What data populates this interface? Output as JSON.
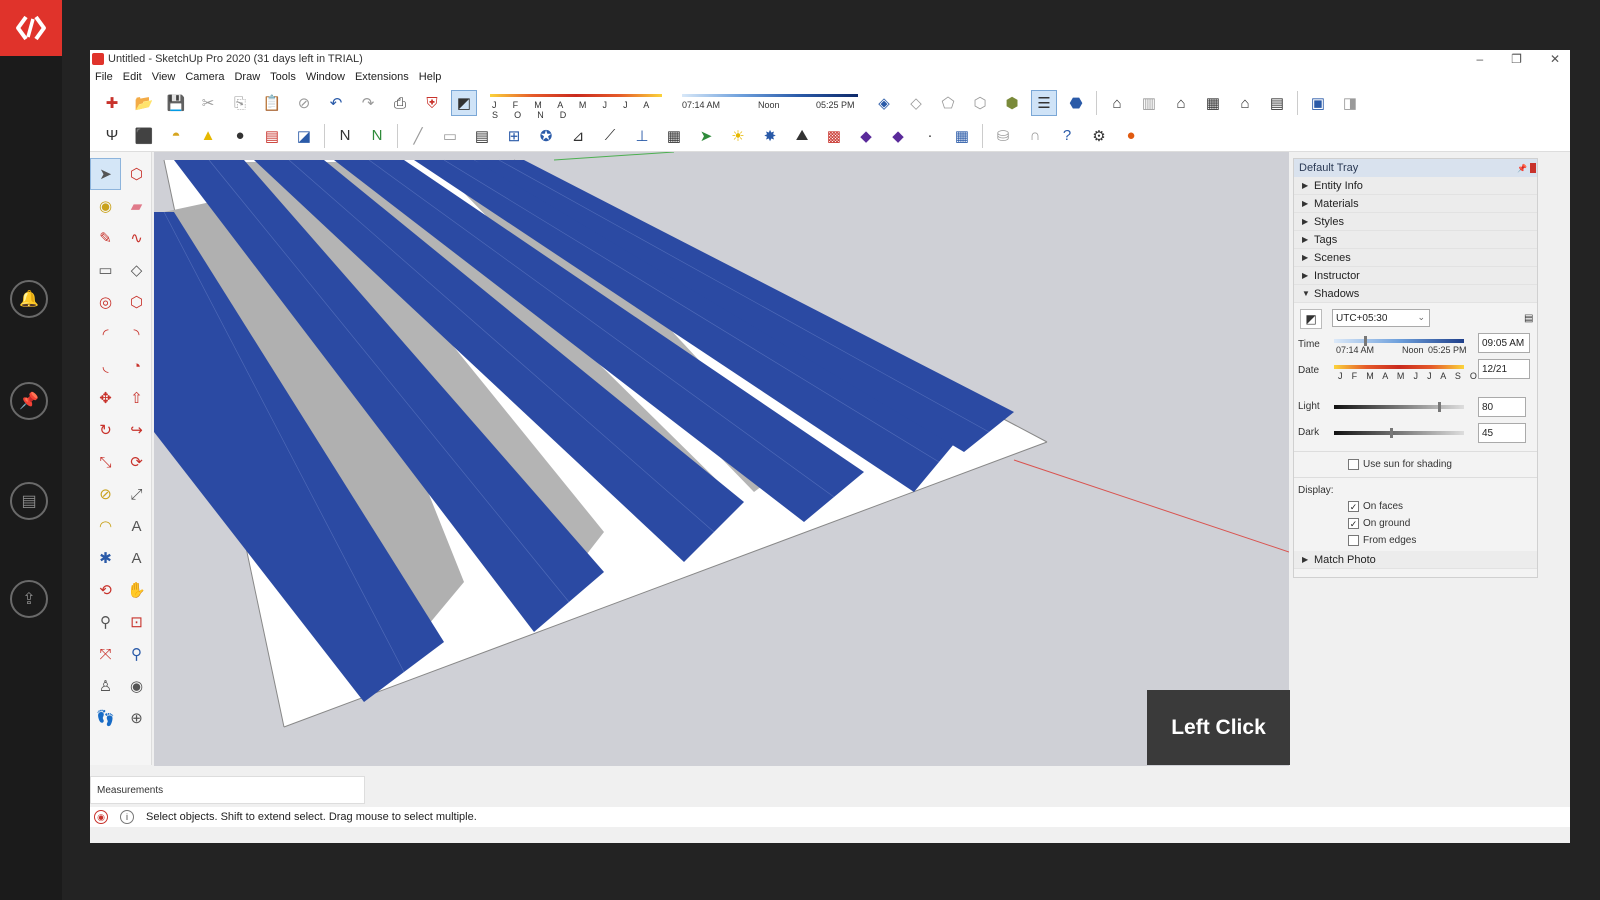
{
  "window": {
    "title": "Untitled - SketchUp Pro 2020 (31 days left in TRIAL)",
    "controls": [
      "–",
      "❐",
      "✕"
    ]
  },
  "menu": [
    "File",
    "Edit",
    "View",
    "Camera",
    "Draw",
    "Tools",
    "Window",
    "Extensions",
    "Help"
  ],
  "toolbar_shadow": {
    "months": "J F M A M J J A S O N D",
    "time_start": "07:14 AM",
    "time_mid": "Noon",
    "time_end": "05:25 PM"
  },
  "tray": {
    "title": "Default Tray",
    "sections": [
      "Entity Info",
      "Materials",
      "Styles",
      "Tags",
      "Scenes",
      "Instructor",
      "Shadows"
    ],
    "shadows": {
      "timezone": "UTC+05:30",
      "time_label": "Time",
      "time_start": "07:14 AM",
      "time_mid": "Noon",
      "time_end": "05:25 PM",
      "time_value": "09:05 AM",
      "date_label": "Date",
      "months": "J F M A M J J A S O N D",
      "date_value": "12/21",
      "light_label": "Light",
      "light_value": "80",
      "light_level": 0.8,
      "dark_label": "Dark",
      "dark_value": "45",
      "dark_level": 0.45,
      "use_sun": "Use sun for shading",
      "display_label": "Display:",
      "on_faces": "On faces",
      "on_ground": "On ground",
      "from_edges": "From edges"
    },
    "match_photo": "Match Photo"
  },
  "overlay": {
    "text": "Left Click"
  },
  "measurements": {
    "label": "Measurements"
  },
  "status": {
    "text": "Select objects. Shift to extend select. Drag mouse to select multiple."
  },
  "colors": {
    "accent_red": "#e0332b",
    "panel_blue": "#2b4aa3",
    "axis_red": "#d9534f",
    "axis_green": "#4caf50"
  }
}
